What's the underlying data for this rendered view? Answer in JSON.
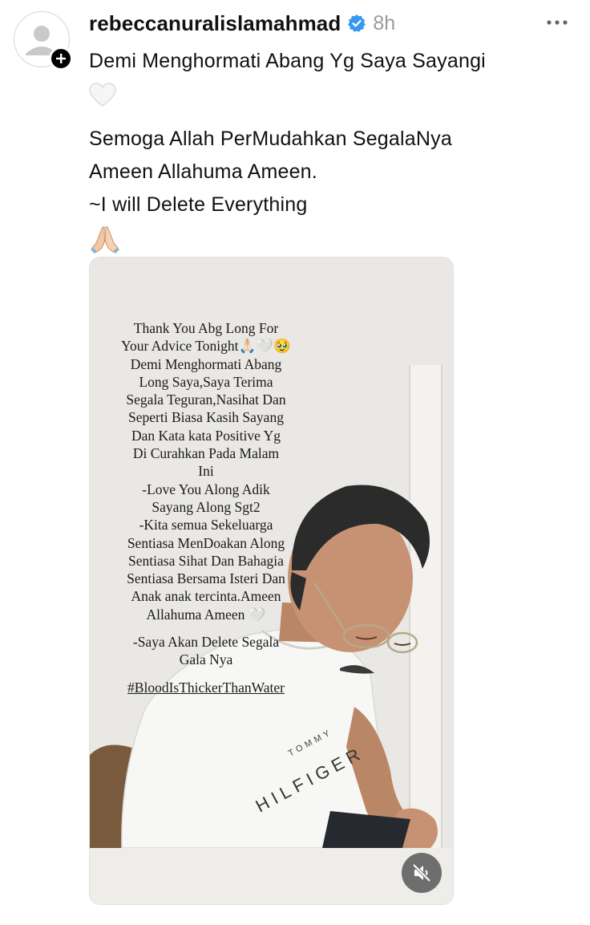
{
  "post": {
    "username": "rebeccanuralislamahmad",
    "time": "8h",
    "verified": true,
    "caption_lines": [
      "Demi Menghormati Abang Yg Saya Sayangi",
      "Semoga Allah PerMudahkan SegalaNya",
      "Ameen Allahuma Ameen.",
      "~I will Delete Everything"
    ],
    "emojis": [
      "white-heart",
      "folded-hands"
    ]
  },
  "story": {
    "lines": [
      "Thank You Abg Long For",
      "Your Advice Tonight🙏🏻🤍🥹",
      "Demi Menghormati Abang",
      "Long Saya,Saya Terima",
      "Segala Teguran,Nasihat Dan",
      "Seperti Biasa Kasih Sayang",
      "Dan Kata kata Positive Yg",
      "Di Curahkan Pada Malam",
      "Ini",
      "-Love You Along Adik",
      "Sayang Along Sgt2",
      "-Kita semua Sekeluarga",
      "Sentiasa MenDoakan Along",
      "Sentiasa Sihat Dan Bahagia",
      "Sentiasa Bersama Isteri Dan",
      "Anak anak tercinta.Ameen",
      "Allahuma Ameen 🤍"
    ],
    "closing_lines": [
      "-Saya Akan Delete Segala",
      "Gala Nya"
    ],
    "hashtag": "#BloodIsThickerThanWater",
    "shirt_brand_small": "TOMMY",
    "shirt_brand_large": "HILFIGER"
  },
  "colors": {
    "verified_blue": "#3897f0",
    "time_gray": "#9a9a9a",
    "mute_button": "#6e6e6e"
  },
  "icons": [
    "avatar-placeholder-icon",
    "follow-plus-icon",
    "verified-badge-icon",
    "more-options-icon",
    "white-heart-icon",
    "folded-hands-icon",
    "muted-speaker-icon"
  ]
}
